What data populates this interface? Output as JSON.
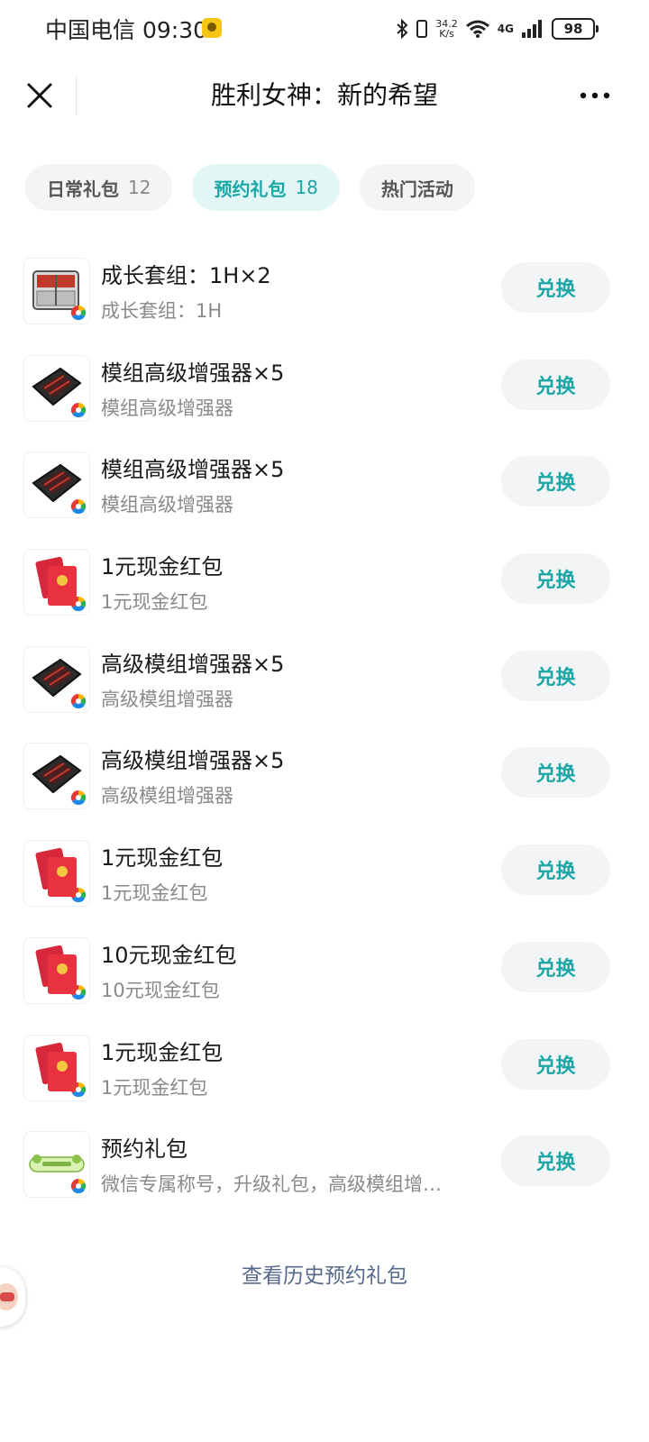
{
  "status_bar": {
    "carrier": "中国电信",
    "time": "09:30",
    "speed_value": "34.2",
    "speed_unit": "K/s",
    "signal": "4G",
    "battery": "98",
    "icons": [
      "bluetooth-icon",
      "vibrate-icon",
      "wifi-icon",
      "signal-icon",
      "battery-icon"
    ]
  },
  "header": {
    "title": "胜利女神：新的希望",
    "close_icon": "close-icon",
    "more_icon": "more-icon"
  },
  "tabs": [
    {
      "label": "日常礼包",
      "count": "12",
      "active": false
    },
    {
      "label": "预约礼包",
      "count": "18",
      "active": true
    },
    {
      "label": "热门活动",
      "count": "",
      "active": false
    }
  ],
  "gifts": [
    {
      "name": "成长套组：1H×2",
      "desc": "成长套组：1H",
      "icon": "supply-crate",
      "button": "兑换"
    },
    {
      "name": "模组高级增强器×5",
      "desc": "模组高级增强器",
      "icon": "module-enhancer",
      "button": "兑换"
    },
    {
      "name": "模组高级增强器×5",
      "desc": "模组高级增强器",
      "icon": "module-enhancer",
      "button": "兑换"
    },
    {
      "name": "1元现金红包",
      "desc": "1元现金红包",
      "icon": "red-envelope",
      "button": "兑换"
    },
    {
      "name": "高级模组增强器×5",
      "desc": "高级模组增强器",
      "icon": "module-enhancer",
      "button": "兑换"
    },
    {
      "name": "高级模组增强器×5",
      "desc": "高级模组增强器",
      "icon": "module-enhancer",
      "button": "兑换"
    },
    {
      "name": "1元现金红包",
      "desc": "1元现金红包",
      "icon": "red-envelope",
      "button": "兑换"
    },
    {
      "name": "10元现金红包",
      "desc": "10元现金红包",
      "icon": "red-envelope",
      "button": "兑换"
    },
    {
      "name": "1元现金红包",
      "desc": "1元现金红包",
      "icon": "red-envelope",
      "button": "兑换"
    },
    {
      "name": "预约礼包",
      "desc": "微信专属称号，升级礼包，高级模组增…",
      "icon": "wechat-title-badge",
      "button": "兑换"
    }
  ],
  "footer": {
    "history_link": "查看历史预约礼包"
  },
  "colors": {
    "accent": "#19a7a7",
    "tab_active_bg": "#e2f6f6",
    "button_bg": "#f3f4f5",
    "link": "#56698c"
  }
}
